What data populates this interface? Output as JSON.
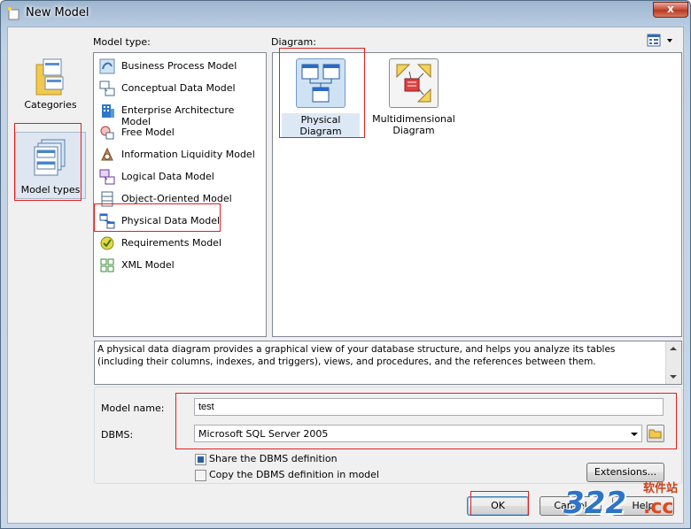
{
  "window": {
    "title": "New Model",
    "close_glyph": "x"
  },
  "labels": {
    "model_type": "Model type:",
    "diagram": "Diagram:",
    "model_name": "Model name:",
    "dbms": "DBMS:"
  },
  "categories": [
    {
      "label": "Categories",
      "icon": "folder-icon"
    },
    {
      "label": "Model types",
      "icon": "model-types-icon",
      "selected": true
    }
  ],
  "model_types": [
    {
      "label": "Business Process Model",
      "icon": "business-process-icon"
    },
    {
      "label": "Conceptual Data Model",
      "icon": "conceptual-data-icon"
    },
    {
      "label": "Enterprise Architecture Model",
      "icon": "enterprise-architecture-icon"
    },
    {
      "label": "Free Model",
      "icon": "free-model-icon"
    },
    {
      "label": "Information Liquidity Model",
      "icon": "information-liquidity-icon"
    },
    {
      "label": "Logical Data Model",
      "icon": "logical-data-icon"
    },
    {
      "label": "Object-Oriented Model",
      "icon": "object-oriented-icon"
    },
    {
      "label": "Physical Data Model",
      "icon": "physical-data-icon",
      "selected": true
    },
    {
      "label": "Requirements Model",
      "icon": "requirements-icon"
    },
    {
      "label": "XML Model",
      "icon": "xml-model-icon"
    }
  ],
  "diagrams": [
    {
      "label": "Physical Diagram",
      "icon": "physical-diagram-icon",
      "selected": true
    },
    {
      "label_line1": "Multidimensional",
      "label_line2": "Diagram",
      "icon": "multidimensional-diagram-icon"
    }
  ],
  "description": "A physical data diagram provides a graphical view of your database structure, and helps you analyze its tables (including their columns, indexes, and triggers), views, and procedures, and the references between them.",
  "form": {
    "model_name_value": "test",
    "dbms_value": "Microsoft SQL Server 2005",
    "share_label": "Share the DBMS definition",
    "share_checked": true,
    "copy_label": "Copy the DBMS definition in model",
    "copy_checked": false,
    "extensions_button": "Extensions..."
  },
  "buttons": {
    "ok": "OK",
    "cancel": "Cancel",
    "help": "Help"
  },
  "watermark": {
    "text": "软件站",
    "number": "322",
    "suffix": ".cc"
  },
  "colors": {
    "highlight_red": "#e02020",
    "selection_blue": "#3399ff",
    "title_bar": "#b9cde2"
  }
}
